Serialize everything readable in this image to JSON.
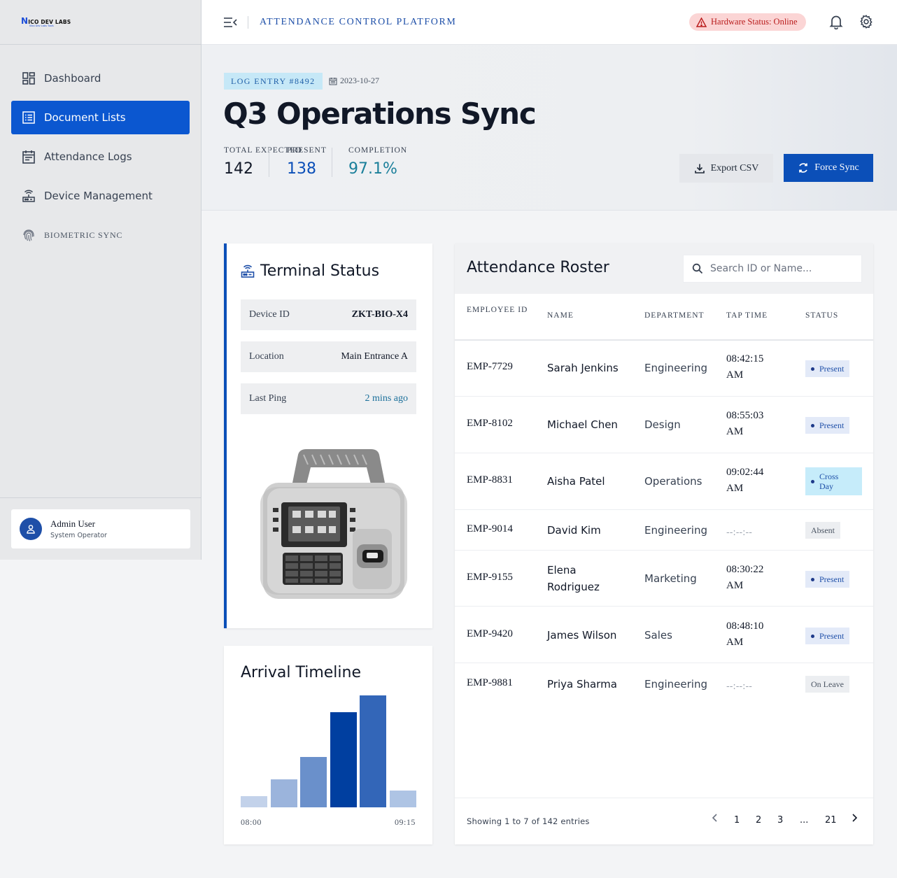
{
  "brand": {
    "logo_text": "ICO DEV LABS",
    "logo_initial": "N",
    "logo_tagline": "Nico Dev Labs Tools"
  },
  "sidebar": {
    "items": [
      {
        "label": "Dashboard",
        "icon": "dashboard-icon"
      },
      {
        "label": "Document Lists",
        "icon": "list-icon",
        "active": true
      },
      {
        "label": "Attendance Logs",
        "icon": "calendar-icon"
      },
      {
        "label": "Device Management",
        "icon": "router-icon"
      },
      {
        "label": "BIOMETRIC SYNC",
        "icon": "fingerprint-icon"
      }
    ],
    "user": {
      "name": "Admin User",
      "role": "System Operator"
    }
  },
  "topbar": {
    "title": "ATTENDANCE CONTROL PLATFORM",
    "hardware_status": "Hardware Status: Online"
  },
  "header": {
    "log_badge": "LOG ENTRY #8492",
    "date": "2023-10-27",
    "title": "Q3 Operations Sync",
    "stats": [
      {
        "label": "TOTAL EXPECTED",
        "value": "142"
      },
      {
        "label": "PRESENT",
        "value": "138"
      },
      {
        "label": "COMPLETION",
        "value": "97.1%"
      }
    ],
    "export_label": "Export CSV",
    "sync_label": "Force Sync"
  },
  "terminal": {
    "title": "Terminal Status",
    "rows": [
      {
        "key": "Device ID",
        "value": "ZKT-BIO-X4"
      },
      {
        "key": "Location",
        "value": "Main Entrance A"
      },
      {
        "key": "Last Ping",
        "value": "2 mins ago"
      }
    ]
  },
  "timeline": {
    "title": "Arrival Timeline",
    "start_label": "08:00",
    "end_label": "09:15",
    "chart_data": {
      "type": "bar",
      "values": [
        10,
        25,
        45,
        85,
        100,
        15
      ],
      "ylim": [
        0,
        100
      ],
      "colors": [
        "#c3d2ea",
        "#9bb4dc",
        "#6a90cb",
        "#003fa0",
        "#3366b8",
        "#aec4e4"
      ]
    }
  },
  "roster": {
    "title": "Attendance Roster",
    "search_placeholder": "Search ID or Name...",
    "columns": [
      "EMPLOYEE ID",
      "NAME",
      "DEPARTMENT",
      "TAP TIME",
      "STATUS"
    ],
    "rows": [
      {
        "id": "EMP-7729",
        "name": "Sarah Jenkins",
        "dept": "Engineering",
        "time": "08:42:15 AM",
        "status": "Present"
      },
      {
        "id": "EMP-8102",
        "name": "Michael Chen",
        "dept": "Design",
        "time": "08:55:03 AM",
        "status": "Present"
      },
      {
        "id": "EMP-8831",
        "name": "Aisha Patel",
        "dept": "Operations",
        "time": "09:02:44 AM",
        "status": "Cross Day"
      },
      {
        "id": "EMP-9014",
        "name": "David Kim",
        "dept": "Engineering",
        "time": "--:--:--",
        "status": "Absent"
      },
      {
        "id": "EMP-9155",
        "name": "Elena Rodriguez",
        "dept": "Marketing",
        "time": "08:30:22 AM",
        "status": "Present"
      },
      {
        "id": "EMP-9420",
        "name": "James Wilson",
        "dept": "Sales",
        "time": "08:48:10 AM",
        "status": "Present"
      },
      {
        "id": "EMP-9881",
        "name": "Priya Sharma",
        "dept": "Engineering",
        "time": "--:--:--",
        "status": "On Leave"
      }
    ],
    "showing": "Showing 1 to 7 of 142 entries",
    "pages": [
      "1",
      "2",
      "3",
      "...",
      "21"
    ]
  },
  "colors": {
    "primary": "#0b4fb8",
    "accent_teal": "#1a7f9a",
    "danger_bg": "#fbd5d5"
  }
}
